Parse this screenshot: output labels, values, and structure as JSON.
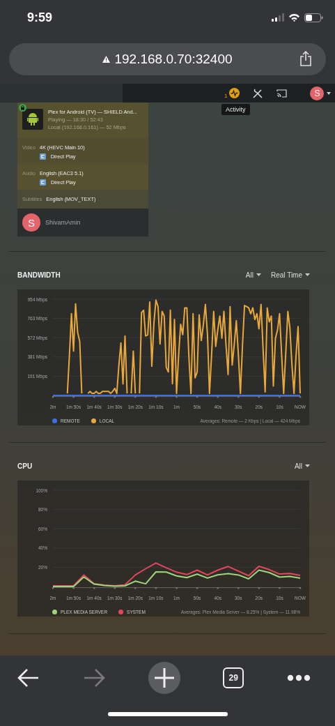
{
  "status_bar": {
    "time": "9:59"
  },
  "browser": {
    "url": "192.168.0.70:32400",
    "tab_count": "29",
    "forward_enabled": false
  },
  "header": {
    "activity_count": "1",
    "tooltip": "Activity",
    "avatar_initial": "S"
  },
  "session": {
    "locked": true,
    "title": "Plex for Android (TV)  —  SHIELD And...",
    "status": "Playing — 18:30 / 52:43",
    "connection": "Local (192.168.0.161) — 52 Mbps",
    "streams": [
      {
        "label": "Video",
        "value": "4K (HEVC Main 10)",
        "decision": "Direct Play"
      },
      {
        "label": "Audio",
        "value": "English (EAC3 5.1)",
        "decision": "Direct Play"
      },
      {
        "label": "Subtitles",
        "value": "English (MOV_TEXT)"
      }
    ],
    "user": {
      "initial": "S",
      "name": "ShivamAmin"
    }
  },
  "sections": [
    {
      "title": "BANDWIDTH",
      "filters": [
        "All",
        "Real Time"
      ],
      "averages": "Averages: Remote — 2 Kbps | Local — 424 Mbps",
      "chart_data": {
        "type": "line",
        "grid": true,
        "categories": [
          "2m",
          null,
          null,
          null,
          null,
          null,
          null,
          null,
          null,
          null,
          "1m 50s",
          null,
          null,
          null,
          null,
          null,
          null,
          null,
          null,
          null,
          "1m 40s",
          null,
          null,
          null,
          null,
          null,
          null,
          null,
          null,
          null,
          "1m 30s",
          null,
          null,
          null,
          null,
          null,
          null,
          null,
          null,
          null,
          "1m 20s",
          null,
          null,
          null,
          null,
          null,
          null,
          null,
          null,
          null,
          "1m 10s",
          null,
          null,
          null,
          null,
          null,
          null,
          null,
          null,
          null,
          "1m",
          null,
          null,
          null,
          null,
          null,
          null,
          null,
          null,
          null,
          "50s",
          null,
          null,
          null,
          null,
          null,
          null,
          null,
          null,
          null,
          "40s",
          null,
          null,
          null,
          null,
          null,
          null,
          null,
          null,
          null,
          "30s",
          null,
          null,
          null,
          null,
          null,
          null,
          null,
          null,
          null,
          "20s",
          null,
          null,
          null,
          null,
          null,
          null,
          null,
          null,
          null,
          "10s",
          null,
          null,
          null,
          null,
          null,
          null,
          null,
          null,
          null,
          "NOW"
        ],
        "series": [
          {
            "name": "REMOTE",
            "color": "#3d6ee8",
            "values": [
              0,
              0,
              0,
              0,
              0,
              0,
              0,
              0,
              0,
              0,
              0,
              0,
              0,
              0,
              0,
              0,
              0,
              0,
              0,
              0,
              0,
              0,
              0,
              0,
              0,
              0,
              0,
              0,
              0,
              0,
              0,
              0,
              0,
              0,
              0,
              0,
              0,
              0,
              0,
              0,
              0,
              0,
              0,
              0,
              0,
              0,
              0,
              0,
              0,
              0,
              0,
              0,
              0,
              0,
              0,
              0,
              0,
              0,
              0,
              0,
              0,
              0,
              0,
              0,
              0,
              0,
              0,
              0,
              0,
              0,
              0,
              0,
              0,
              0,
              0,
              0,
              0,
              0,
              0,
              0,
              0,
              0,
              0,
              0,
              0,
              0,
              0,
              0,
              0,
              0,
              0,
              0,
              0,
              0,
              0,
              0,
              0,
              0,
              0,
              0,
              0,
              0,
              0,
              0,
              0,
              0,
              0,
              0,
              0,
              0,
              0,
              0,
              0,
              0,
              0,
              0,
              0,
              0,
              0,
              0,
              0
            ]
          },
          {
            "name": "LOCAL",
            "color": "#e8a83a",
            "values": [
              null,
              null,
              null,
              null,
              null,
              null,
              null,
              20,
              400,
              810,
              440,
              908,
              625,
              533,
              20,
              null,
              null,
              20,
              40,
              20,
              20,
              40,
              20,
              20,
              40,
              40,
              40,
              40,
              20,
              40,
              70,
              20,
              300,
              520,
              115,
              590,
              20,
              null,
              20,
              440,
              20,
              null,
              20,
              822,
              845,
              590,
              600,
              926,
              290,
              718,
              945,
              880,
              510,
              834,
              787,
              278,
              232,
              845,
              116,
              753,
              20,
              400,
              706,
              602,
              868,
              868,
              370,
              20,
              810,
              174,
              232,
              799,
              544,
              700,
              903,
              602,
              20,
              400,
              834,
              486,
              650,
              787,
              567,
              834,
              500,
              208,
              880,
              301,
              500,
              741,
              400,
              20,
              500,
              892,
              880,
              868,
              810,
              868,
              753,
              810,
              660,
              903,
              450,
              35,
              868,
              730,
              787,
              93,
              567,
              650,
              810,
              400,
              20,
              420,
              834,
              672,
              300,
              20,
              400,
              683,
              20
            ]
          }
        ],
        "ylim": [
          0,
          954
        ],
        "yticks": [
          {
            "value": 191,
            "label": "191 Mbps"
          },
          {
            "value": 381,
            "label": "381 Mbps"
          },
          {
            "value": 572,
            "label": "572 Mbps"
          },
          {
            "value": 763,
            "label": "763 Mbps"
          },
          {
            "value": 954,
            "label": "954 Mbps"
          }
        ]
      }
    },
    {
      "title": "CPU",
      "filters": [
        "All"
      ],
      "averages": "Averages: Plex Media Server — 8.25% | System — 11.98%",
      "chart_data": {
        "type": "line",
        "grid": true,
        "categories": [
          "2m",
          null,
          "1m 50s",
          null,
          "1m 40s",
          null,
          "1m 30s",
          null,
          "1m 20s",
          null,
          "1m 10s",
          null,
          "1m",
          null,
          "50s",
          null,
          "40s",
          null,
          "30s",
          null,
          "20s",
          null,
          "10s",
          null,
          "NOW"
        ],
        "series": [
          {
            "name": "PLEX MEDIA SERVER",
            "color": "#9bd67c",
            "values": [
              0,
              0,
              0,
              10,
              2.5,
              1,
              0.3,
              0.7,
              5.6,
              2.8,
              15.2,
              15,
              11,
              9.3,
              12.8,
              8.8,
              12.2,
              13.3,
              12,
              8,
              17,
              14.5,
              9.8,
              10.5,
              8.8
            ]
          },
          {
            "name": "SYSTEM",
            "color": "#e8445e",
            "values": [
              0.7,
              0.7,
              0.7,
              12,
              3,
              1.5,
              0.8,
              1.8,
              12,
              18.5,
              24.4,
              19.5,
              15,
              12.5,
              17,
              12,
              17,
              20.8,
              16,
              11.2,
              21,
              17.5,
              13,
              13.6,
              11.7
            ]
          }
        ],
        "ylim": [
          0,
          100
        ],
        "yticks": [
          {
            "value": 20,
            "label": "20%"
          },
          {
            "value": 40,
            "label": "40%"
          },
          {
            "value": 60,
            "label": "60%"
          },
          {
            "value": 80,
            "label": "80%"
          },
          {
            "value": 100,
            "label": "100%"
          }
        ]
      }
    }
  ]
}
